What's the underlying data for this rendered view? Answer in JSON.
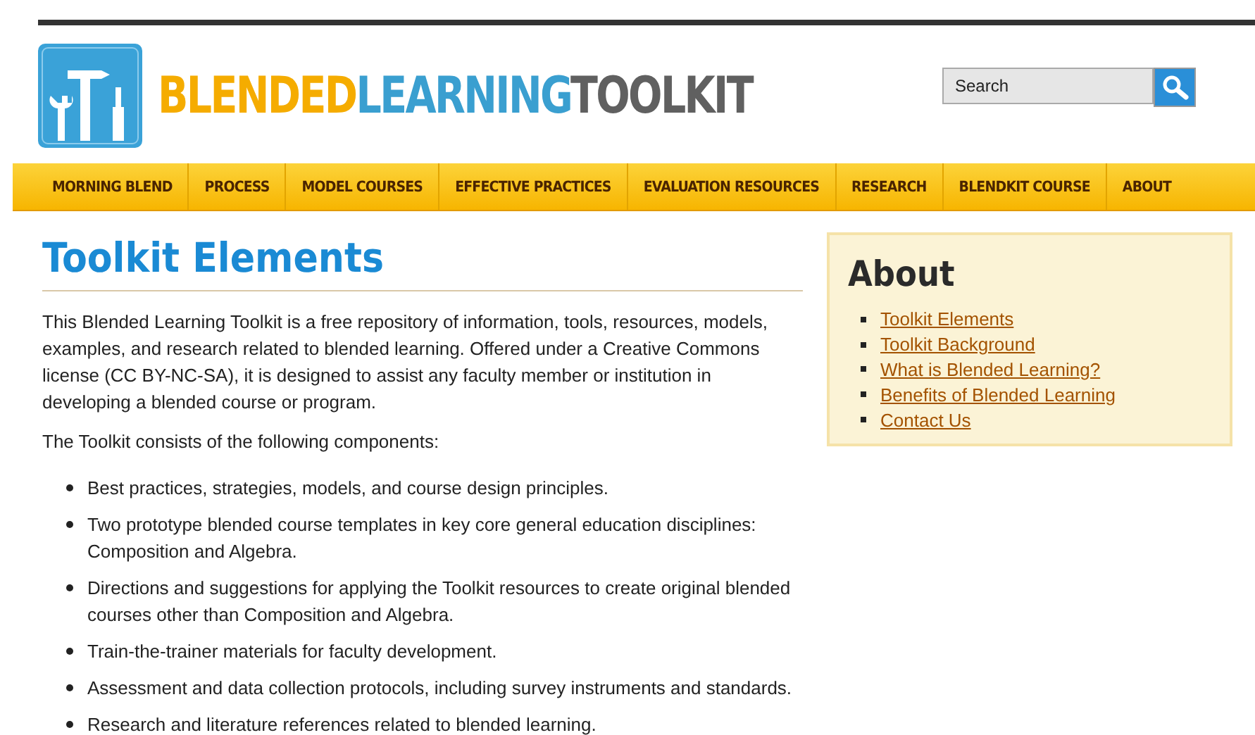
{
  "logo": {
    "parts": [
      {
        "text": "BLENDED",
        "color": "#f5ac00"
      },
      {
        "text": "LEARNING",
        "color": "#3a9fd0"
      },
      {
        "text": "TOOLKIT",
        "color": "#606060"
      }
    ]
  },
  "search": {
    "placeholder": "Search"
  },
  "nav": [
    {
      "label": "MORNING BLEND"
    },
    {
      "label": "PROCESS"
    },
    {
      "label": "MODEL COURSES"
    },
    {
      "label": "EFFECTIVE PRACTICES"
    },
    {
      "label": "EVALUATION RESOURCES"
    },
    {
      "label": "RESEARCH"
    },
    {
      "label": "BLENDKIT COURSE"
    },
    {
      "label": "ABOUT"
    }
  ],
  "main": {
    "title": "Toolkit Elements",
    "intro": "This Blended Learning Toolkit is a free repository of information, tools, resources, models, examples, and research related to blended learning. Offered under a Creative Commons license (CC BY-NC-SA), it is designed to assist any faculty member or institution in developing a blended course or program.",
    "lead": "The Toolkit consists of the following components:",
    "items": [
      "Best practices, strategies, models, and course design principles.",
      "Two prototype blended course templates in key core general education disciplines: Composition and Algebra.",
      "Directions and suggestions for applying the Toolkit resources to create original blended courses other than Composition and Algebra.",
      "Train-the-trainer materials for faculty development.",
      "Assessment and data collection protocols, including survey instruments and standards.",
      "Research and literature references related to blended learning."
    ]
  },
  "sidebar": {
    "title": "About",
    "links": [
      "Toolkit Elements",
      "Toolkit Background",
      "What is Blended Learning?",
      "Benefits of Blended Learning",
      "Contact Us"
    ]
  }
}
